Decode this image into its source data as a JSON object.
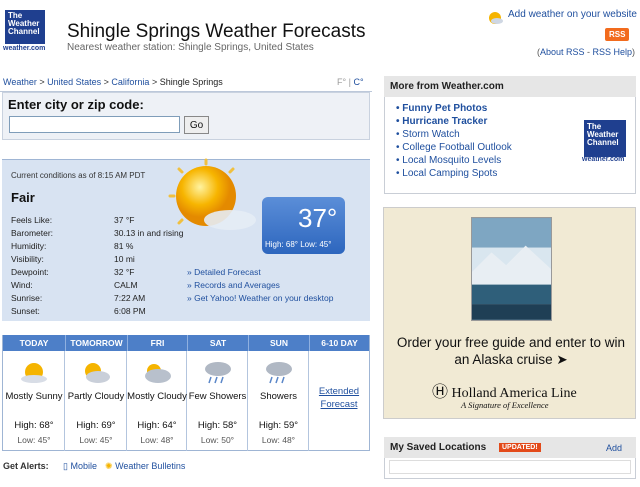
{
  "header": {
    "logo_text": "The Weather Channel",
    "logo_sub": "weather.com",
    "title": "Shingle Springs Weather Forecasts",
    "subtitle": "Nearest weather station: Shingle Springs, United States",
    "add_weather": "Add weather on your website",
    "rss": "RSS",
    "about_rss": "About RSS",
    "rss_help": "RSS Help"
  },
  "breadcrumb": {
    "items": [
      "Weather",
      "United States",
      "California",
      "Shingle Springs"
    ],
    "units_f": "F°",
    "units_c": "C°"
  },
  "search": {
    "label": "Enter city or zip code:",
    "value": "",
    "go": "Go"
  },
  "current": {
    "as_of": "Current conditions as of 8:15 AM PDT",
    "condition": "Fair",
    "temp": "37°",
    "high": "High: 68°",
    "low": "Low: 45°",
    "rows": [
      {
        "label": "Feels Like:",
        "value": "37 °F"
      },
      {
        "label": "Barometer:",
        "value": "30.13 in and rising"
      },
      {
        "label": "Humidity:",
        "value": "81 %"
      },
      {
        "label": "Visibility:",
        "value": "10 mi"
      },
      {
        "label": "Dewpoint:",
        "value": "32 °F"
      },
      {
        "label": "Wind:",
        "value": "CALM"
      },
      {
        "label": "Sunrise:",
        "value": "7:22 AM"
      },
      {
        "label": "Sunset:",
        "value": "6:08 PM"
      }
    ],
    "links": [
      "» Detailed Forecast",
      "» Records and Averages",
      "» Get Yahoo! Weather on your desktop"
    ]
  },
  "forecast": {
    "days": [
      {
        "day": "TODAY",
        "cond": "Mostly Sunny",
        "high": "High: 68°",
        "low": "Low: 45°",
        "icon": "sun-cloud-icon"
      },
      {
        "day": "TOMORROW",
        "cond": "Partly Cloudy",
        "high": "High: 69°",
        "low": "Low: 45°",
        "icon": "partly-cloudy-icon"
      },
      {
        "day": "FRI",
        "cond": "Mostly Cloudy",
        "high": "High: 64°",
        "low": "Low: 48°",
        "icon": "mostly-cloudy-icon"
      },
      {
        "day": "SAT",
        "cond": "Few Showers",
        "high": "High: 58°",
        "low": "Low: 50°",
        "icon": "showers-icon"
      },
      {
        "day": "SUN",
        "cond": "Showers",
        "high": "High: 59°",
        "low": "Low: 48°",
        "icon": "showers-icon"
      }
    ],
    "extended_header": "6-10 DAY",
    "extended_link": "Extended Forecast"
  },
  "alerts": {
    "label": "Get Alerts:",
    "mobile": "Mobile",
    "bulletins": "Weather Bulletins"
  },
  "more": {
    "title": "More from Weather.com",
    "items": [
      "Funny Pet Photos",
      "Hurricane Tracker",
      "Storm Watch",
      "College Football Outlook",
      "Local Mosquito Levels",
      "Local Camping Spots"
    ]
  },
  "ad": {
    "text": "Order your free guide and enter to win an Alaska cruise ➤",
    "brand": "Holland America Line",
    "tagline": "A Signature of Excellence"
  },
  "saved": {
    "title": "My Saved Locations",
    "badge": "UPDATED!",
    "add": "Add"
  },
  "colors": {
    "link": "#1f4f9e",
    "header_blue": "#4d7fc8",
    "panel_blue": "#d8e3f2",
    "rss_orange": "#f26b1d"
  }
}
